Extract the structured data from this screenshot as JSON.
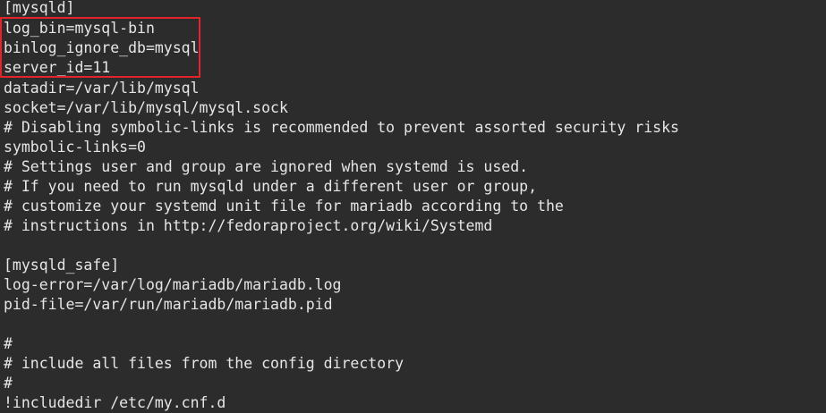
{
  "terminal": {
    "lines": [
      "[mysqld]",
      "log_bin=mysql-bin",
      "binlog_ignore_db=mysql",
      "server_id=11",
      "datadir=/var/lib/mysql",
      "socket=/var/lib/mysql/mysql.sock",
      "# Disabling symbolic-links is recommended to prevent assorted security risks",
      "symbolic-links=0",
      "# Settings user and group are ignored when systemd is used.",
      "# If you need to run mysqld under a different user or group,",
      "# customize your systemd unit file for mariadb according to the",
      "# instructions in http://fedoraproject.org/wiki/Systemd",
      "",
      "[mysqld_safe]",
      "log-error=/var/log/mariadb/mariadb.log",
      "pid-file=/var/run/mariadb/mariadb.pid",
      "",
      "#",
      "# include all files from the config directory",
      "#",
      "!includedir /etc/my.cnf.d"
    ]
  },
  "colors": {
    "background": "#2c2c2c",
    "text": "#e6e6e6",
    "highlight": "#e3252b"
  }
}
